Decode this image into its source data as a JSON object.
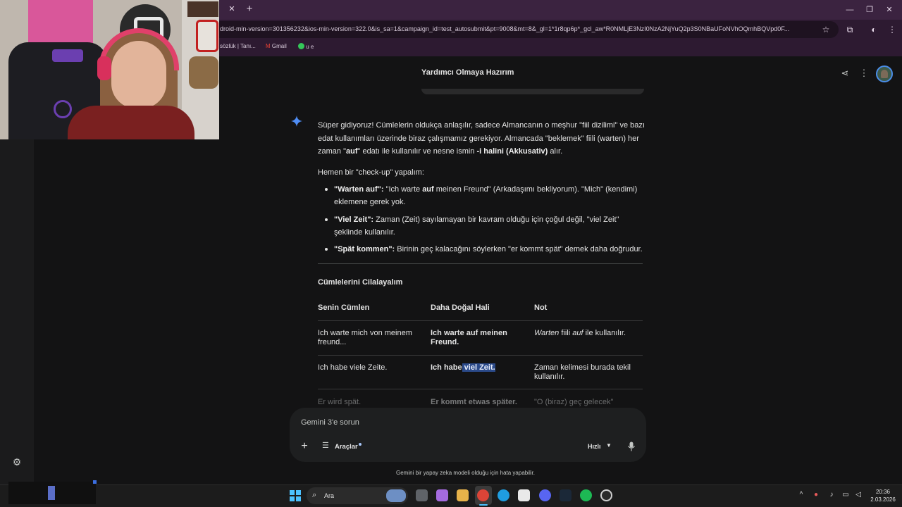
{
  "browser": {
    "url": "droid-min-version=301356232&ios-min-version=322.0&is_sa=1&campaign_id=test_autosubmit&pt=9008&mt=8&_gl=1*1r8qp6p*_gcl_aw*R0NMLjE3NzI0NzA2NjYuQ2p3S0NBaUFoNVhOQmhBQVpd0F...",
    "bookmarks": [
      "sözlük | Tanı...",
      "Gmail",
      "u e"
    ]
  },
  "chat": {
    "title": "Yardımcı Olmaya Hazırım",
    "intro": {
      "s1": "Süper gidiyoruz! Cümlelerin oldukça anlaşılır, sadece Almancanın o meşhur \"fiil dizilimi\" ve bazı",
      "s2": "edat kullanımları üzerinde biraz çalışmamız gerekiyor. Almancada \"beklemek\" fiili (warten) her",
      "s3a": "zaman \"",
      "s3b": "auf",
      "s3c": "\" edatı ile kullanılır ve nesne ismin ",
      "s3d": "-i halini (Akkusativ)",
      "s3e": " alır."
    },
    "checkup": "Hemen bir \"check-up\" yapalım:",
    "bullets": [
      {
        "term": "\"Warten auf\":",
        "l1a": " \"Ich warte ",
        "l1b": "auf",
        "l1c": " meinen Freund\" (Arkadaşımı bekliyorum). \"Mich\" (kendimi)",
        "l2": "eklemene gerek yok."
      },
      {
        "term": "\"Viel Zeit\":",
        "l1": " Zaman (Zeit) sayılamayan bir kavram olduğu için çoğul değil, \"viel Zeit\"",
        "l2": "şeklinde kullanılır."
      },
      {
        "term": "\"Spät kommen\":",
        "l1": " Birinin geç kalacağını söylerken \"er kommt spät\" demek daha doğrudur."
      }
    ],
    "section_title": "Cümlelerini Cilalayalım",
    "table": {
      "headers": [
        "Senin Cümlen",
        "Daha Doğal Hali",
        "Not"
      ],
      "rows": [
        {
          "orig_l1": "Ich warte mich von meinem",
          "orig_l2": "freund...",
          "nat_l1": "Ich warte auf meinen",
          "nat_l2": "Freund.",
          "note_a": "Warten",
          "note_b": " fiili ",
          "note_c": "auf",
          "note_d": " ile kullanılır."
        },
        {
          "orig_l1": "Ich habe viele Zeite.",
          "nat_plain": "Ich habe",
          "nat_sel": " viel Zeit.",
          "note_l1": "Zaman kelimesi burada tekil",
          "note_l2": "kullanılır."
        },
        {
          "orig_l1": "Er wird spät.",
          "nat_l1": "Er kommt etwas später.",
          "note_l1": "\"O (biraz) geç gelecek\""
        }
      ]
    }
  },
  "composer": {
    "placeholder": "Gemini 3'e sorun",
    "tools_label": "Araçlar",
    "model_label": "Hızlı",
    "disclaimer": "Gemini bir yapay zeka modeli olduğu için hata yapabilir."
  },
  "taskbar": {
    "search_label": "Ara",
    "time": "20:36",
    "date": "2.03.2026"
  },
  "colors": {
    "background": "#131314",
    "tabstrip": "#3b2340",
    "accent": "#4cc2ff",
    "selection": "#2b4a8a"
  }
}
